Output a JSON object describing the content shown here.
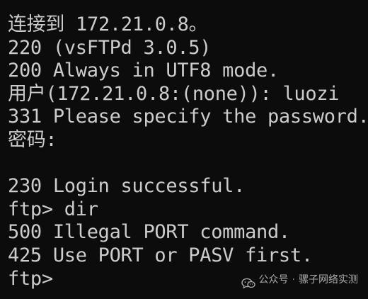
{
  "terminal": {
    "lines": [
      "连接到 172.21.0.8。",
      "220 (vsFTPd 3.0.5)",
      "200 Always in UTF8 mode.",
      "用户(172.21.0.8:(none)): luozi",
      "331 Please specify the password.",
      "密码:",
      "",
      "230 Login successful.",
      "ftp> dir",
      "500 Illegal PORT command.",
      "425 Use PORT or PASV first.",
      "ftp>"
    ]
  },
  "watermark": {
    "icon": "wechat-icon",
    "prefix": "公众号",
    "separator": "·",
    "name": "骡子网络实测"
  },
  "colors": {
    "background": "#0c0c0c",
    "text": "#cccccc"
  }
}
